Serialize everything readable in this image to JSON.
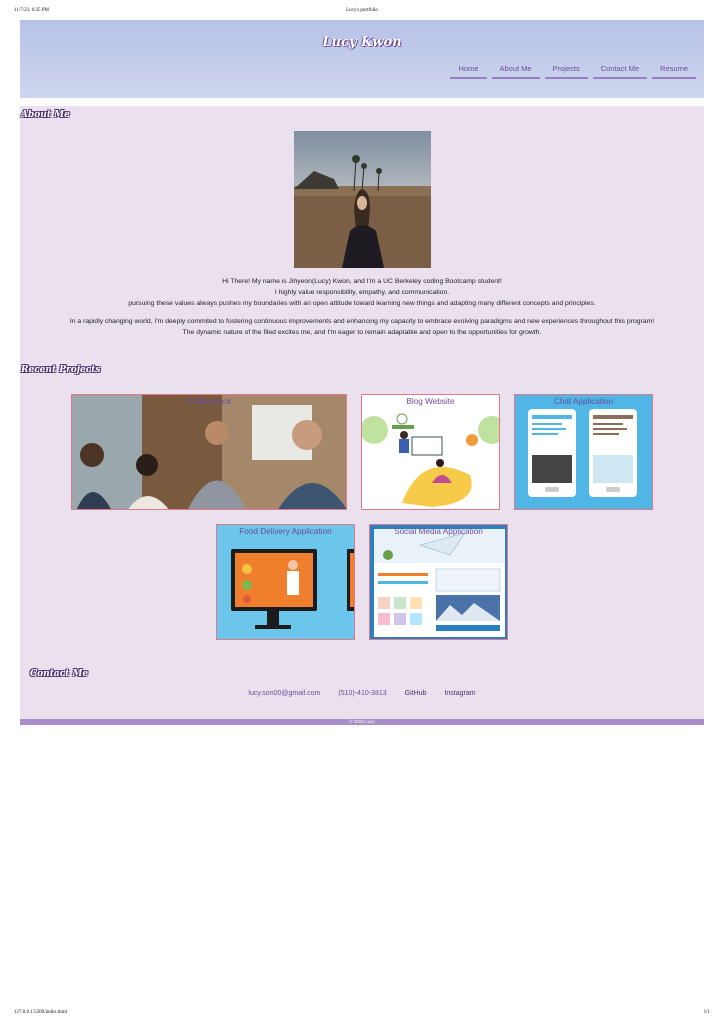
{
  "print": {
    "datetime": "11/7/23, 6:35 PM",
    "doc_title": "Lucy's portfolio",
    "url": "127.0.0.1:5500/index.html",
    "page": "1/1"
  },
  "site": {
    "title": "Lucy Kwon"
  },
  "nav": [
    {
      "label": "Home"
    },
    {
      "label": "About Me"
    },
    {
      "label": "Projects"
    },
    {
      "label": "Contact Me"
    },
    {
      "label": "Resume"
    }
  ],
  "about": {
    "heading": "About Me",
    "lines": [
      "Hi There! My name is Jihyeon(Lucy) Kwon, and I'm a UC Berkeley coding Bootcamp student!",
      "I highly value responsibility, empathy, and communication.",
      "pursuing these values always pushes my boundaries with an open attitude toward learning new things and adapting many different concepts and principles.",
      "In a rapidly changing world, I'm deeply commited to fostering continuous improvements and enhancing my capacity to embrace evolving paradigms and new experiences throughout this program!",
      "The dynamic nature of the filed excites me, and I'm eager to remain adaptable and open to the opportunities for growth."
    ]
  },
  "projects": {
    "heading": "Recent Projects",
    "items": [
      {
        "title": "Rubberduck"
      },
      {
        "title": "Blog Website"
      },
      {
        "title": "Chat Application"
      },
      {
        "title": "Food Delivery Application"
      },
      {
        "title": "Social Media Application"
      }
    ]
  },
  "contact": {
    "heading": "Contact Me",
    "email": "lucy.son00@gmail.com",
    "phone": "(510)-410-3813",
    "github": "GitHub",
    "instagram": "Instagram"
  },
  "footer": {
    "text": "© 2023 Lucy"
  },
  "colors": {
    "header": "#b8c3e6",
    "main_bg": "#ebe1ee",
    "accent": "#6b4c9a",
    "footer": "#a88dc8",
    "card_border": "#e07a8a"
  }
}
